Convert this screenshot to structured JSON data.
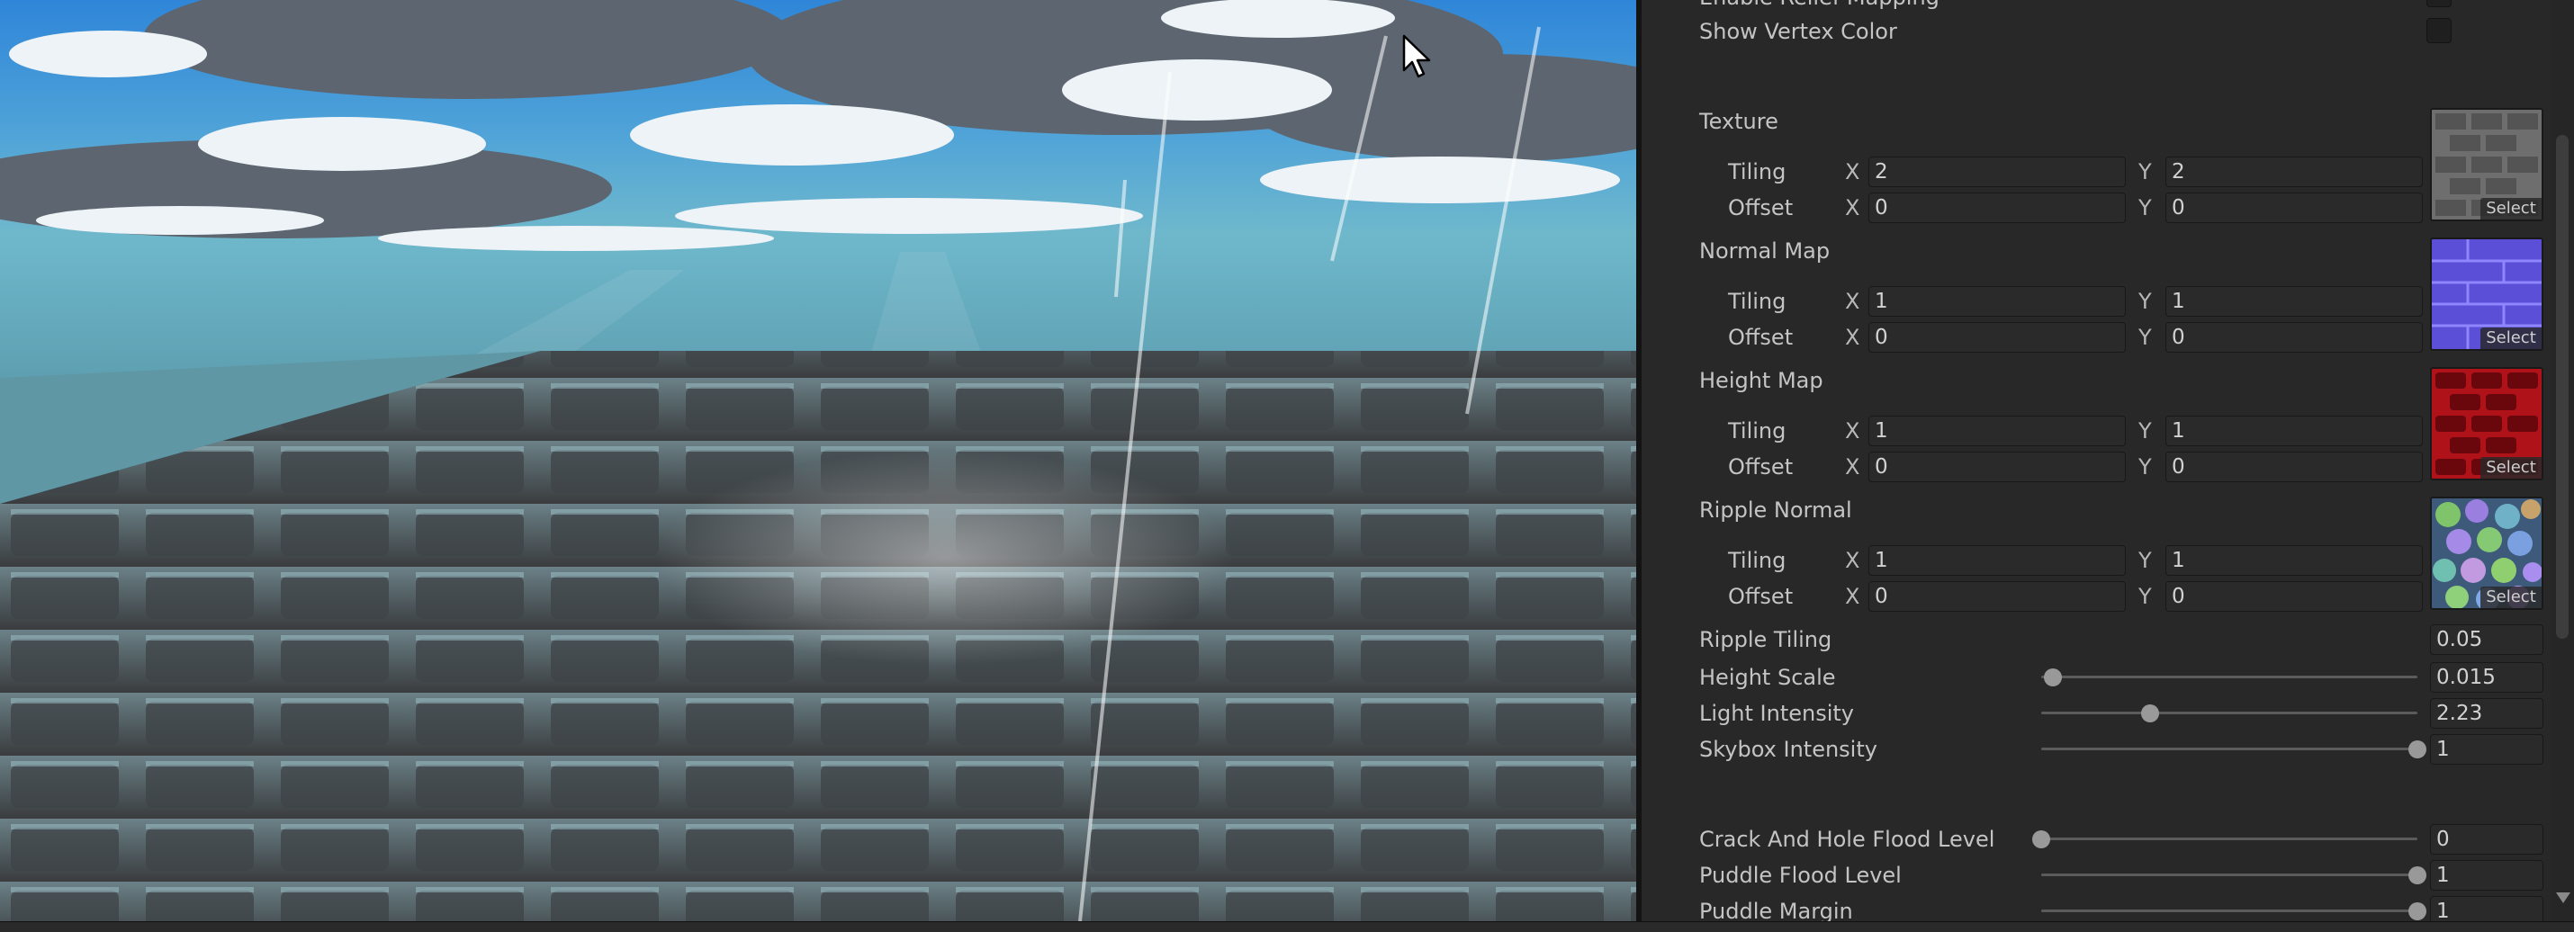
{
  "inspector": {
    "enable_relief_mapping_label": "Enable Relief Mapping",
    "show_vertex_color_label": "Show Vertex Color",
    "texture_slots": [
      {
        "label": "Texture",
        "tiling_label": "Tiling",
        "offset_label": "Offset",
        "tiling_x": "2",
        "tiling_y": "2",
        "offset_x": "0",
        "offset_y": "0",
        "select_label": "Select",
        "thumb_icon": "stone-tile-texture"
      },
      {
        "label": "Normal Map",
        "tiling_label": "Tiling",
        "offset_label": "Offset",
        "tiling_x": "1",
        "tiling_y": "1",
        "offset_x": "0",
        "offset_y": "0",
        "select_label": "Select",
        "thumb_icon": "normal-map-texture"
      },
      {
        "label": "Height Map",
        "tiling_label": "Tiling",
        "offset_label": "Offset",
        "tiling_x": "1",
        "tiling_y": "1",
        "offset_x": "0",
        "offset_y": "0",
        "select_label": "Select",
        "thumb_icon": "height-map-texture"
      },
      {
        "label": "Ripple Normal",
        "tiling_label": "Tiling",
        "offset_label": "Offset",
        "tiling_x": "1",
        "tiling_y": "1",
        "offset_x": "0",
        "offset_y": "0",
        "select_label": "Select",
        "thumb_icon": "ripple-normal-texture"
      }
    ],
    "axis_x": "X",
    "axis_y": "Y",
    "ripple_tiling": {
      "label": "Ripple Tiling",
      "value": "0.05"
    },
    "sliders": [
      {
        "label": "Height Scale",
        "value": "0.015",
        "level": 0.03
      },
      {
        "label": "Light Intensity",
        "value": "2.23",
        "level": 0.29
      },
      {
        "label": "Skybox Intensity",
        "value": "1",
        "level": 1.0
      },
      {
        "label": "Crack And Hole Flood Level",
        "value": "0",
        "level": 0.0
      },
      {
        "label": "Puddle Flood Level",
        "value": "1",
        "level": 1.0
      },
      {
        "label": "Puddle Margin",
        "value": "1",
        "level": 1.0
      }
    ]
  },
  "colors": {
    "panel_bg": "#282828",
    "field_bg": "#2a2a2a",
    "knob": "#999999",
    "height_map_red": "#b0121a",
    "normal_map_blue": "#5a4fd6"
  }
}
